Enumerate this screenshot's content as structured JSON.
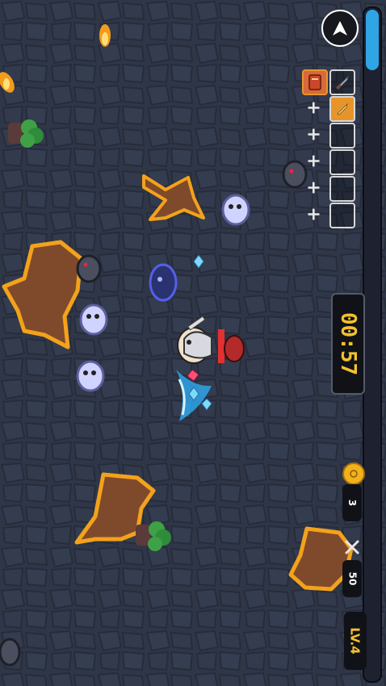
{
  "hud": {
    "timer": "00:57",
    "coins": "3",
    "kills": "50",
    "level": "LV.4",
    "xp_progress": 0.09
  },
  "icons": {
    "pause": "pause-button-icon",
    "coin": "coin-icon",
    "kills": "crossed-swords-icon",
    "weapon": "sword-icon",
    "armor": "armor-icon",
    "book": "spellbook-icon"
  },
  "colors": {
    "ground": "#2f3647",
    "lava": "#f3a21b",
    "xp": "#2fa5e6",
    "timer_text": "#f3c12f",
    "hp_bar": "#e33030"
  },
  "skill_slots": {
    "weapons": [
      {
        "icon": "sword-icon",
        "empty": false
      },
      {
        "icon": "armor-icon",
        "empty": false
      },
      {
        "icon": "",
        "empty": true
      },
      {
        "icon": "",
        "empty": true
      },
      {
        "icon": "",
        "empty": true
      },
      {
        "icon": "",
        "empty": true
      }
    ],
    "passives": [
      {
        "icon": "spellbook-icon",
        "empty": false
      },
      {
        "icon": "plus",
        "empty": true
      },
      {
        "icon": "plus",
        "empty": true
      },
      {
        "icon": "plus",
        "empty": true
      },
      {
        "icon": "plus",
        "empty": true
      },
      {
        "icon": "plus",
        "empty": true
      }
    ]
  }
}
